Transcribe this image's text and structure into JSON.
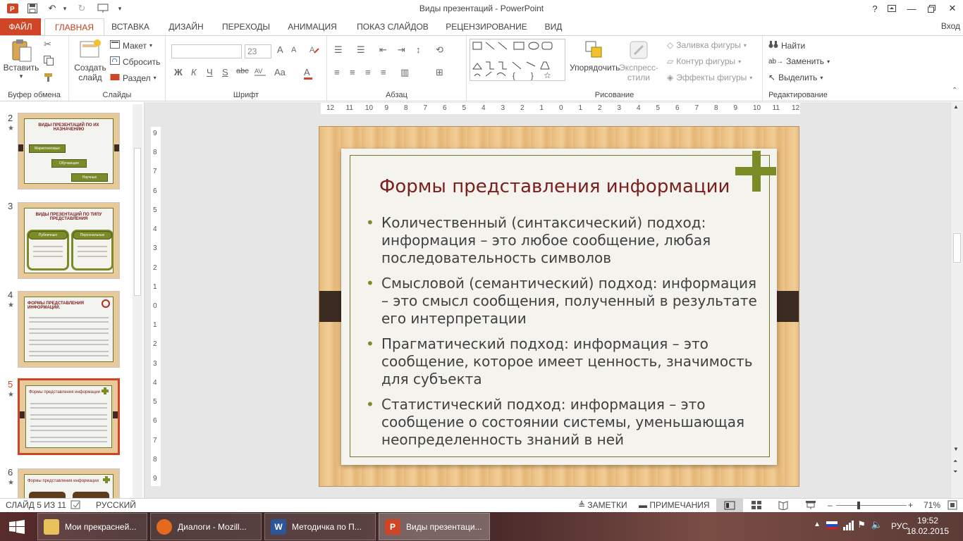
{
  "window": {
    "title": "Виды презентаций - PowerPoint",
    "help": "?",
    "login": "Вход"
  },
  "tabs": [
    "ФАЙЛ",
    "ГЛАВНАЯ",
    "ВСТАВКА",
    "ДИЗАЙН",
    "ПЕРЕХОДЫ",
    "АНИМАЦИЯ",
    "ПОКАЗ СЛАЙДОВ",
    "РЕЦЕНЗИРОВАНИЕ",
    "ВИД"
  ],
  "ribbon": {
    "clipboard": {
      "label": "Буфер обмена",
      "paste": "Вставить"
    },
    "slides": {
      "label": "Слайды",
      "new_slide": "Создать слайд",
      "layout": "Макет",
      "reset": "Сбросить",
      "section": "Раздел"
    },
    "font": {
      "label": "Шрифт",
      "size": "23",
      "bold": "Ж",
      "italic": "К",
      "underline": "Ч",
      "strike": "S",
      "spacing": "abc",
      "case": "Aa",
      "color": "A",
      "grow": "A",
      "shrink": "A"
    },
    "paragraph": {
      "label": "Абзац"
    },
    "drawing": {
      "label": "Рисование",
      "arrange": "Упорядочить",
      "styles": "Экспресс-стили",
      "fill": "Заливка фигуры",
      "outline": "Контур фигуры",
      "effects": "Эффекты фигуры"
    },
    "editing": {
      "label": "Редактирование",
      "find": "Найти",
      "replace": "Заменить",
      "select": "Выделить"
    }
  },
  "thumbnails": [
    {
      "num": "2",
      "title": "ВИДЫ ПРЕЗЕНТАЦИЙ ПО ИХ НАЗНАЧЕНИЮ",
      "pills": [
        "Маркетинговые",
        "Обучающие",
        "Научные"
      ]
    },
    {
      "num": "3",
      "title": "ВИДЫ ПРЕЗЕНТАЦИЙ ПО ТИПУ ПРЕДСТАВЛЕНИЯ",
      "pills": [
        "Публичные",
        "Персональные"
      ]
    },
    {
      "num": "4",
      "title": "ФОРМЫ ПРЕДСТАВЛЕНИЯ ИНФОРМАЦИИ."
    },
    {
      "num": "5",
      "title": "Формы представления информации"
    },
    {
      "num": "6",
      "title": "Формы представления информации"
    }
  ],
  "slide": {
    "title": "Формы представления информации",
    "bullets": [
      "Количественный (синтаксический) подход: информация – это любое сообщение, любая последовательность символов",
      "Смысловой (семантический) подход: информация – это смысл сообщения, полученный в результате его интерпретации",
      "Прагматический подход: информация – это сообщение, которое имеет ценность, значимость для субъекта",
      "Статистический подход: информация – это сообщение о состоянии системы, уменьшающая неопределенность знаний в ней"
    ]
  },
  "ruler": {
    "h": [
      "12",
      "11",
      "10",
      "9",
      "8",
      "7",
      "6",
      "5",
      "4",
      "3",
      "2",
      "1",
      "0",
      "1",
      "2",
      "3",
      "4",
      "5",
      "6",
      "7",
      "8",
      "9",
      "10",
      "11",
      "12"
    ],
    "v": [
      "9",
      "8",
      "7",
      "6",
      "5",
      "4",
      "3",
      "2",
      "1",
      "0",
      "1",
      "2",
      "3",
      "4",
      "5",
      "6",
      "7",
      "8",
      "9"
    ]
  },
  "status": {
    "slide": "СЛАЙД 5 ИЗ 11",
    "lang": "РУССКИЙ",
    "notes": "ЗАМЕТКИ",
    "comments": "ПРИМЕЧАНИЯ",
    "minus": "–",
    "plus": "+",
    "zoom": "71%"
  },
  "taskbar": {
    "items": [
      {
        "label": "Мои прекрасней..."
      },
      {
        "label": "Диалоги - Mozill..."
      },
      {
        "label": "Методичка по П..."
      },
      {
        "label": "Виды презентаци..."
      }
    ],
    "lang": "РУС",
    "time": "19:52",
    "date": "18.02.2015"
  },
  "colors": {
    "accent": "#d04526",
    "slide_title": "#7b1e1e",
    "bullet": "#7b8b25"
  }
}
